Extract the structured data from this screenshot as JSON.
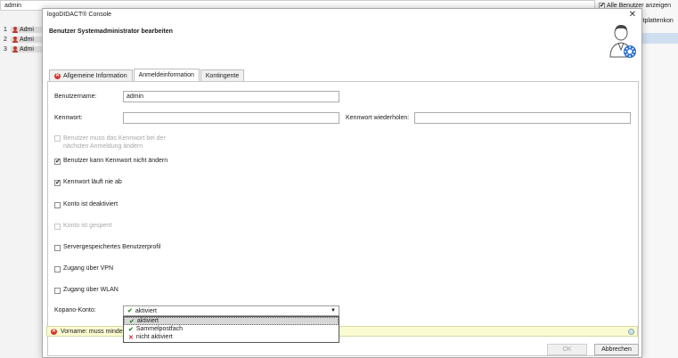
{
  "background": {
    "search_value": "admin",
    "show_all_label": "Alle Benutzer anzeigen",
    "column_header": "stplattenkon",
    "rows": [
      {
        "num": "1",
        "name": "Admi"
      },
      {
        "num": "2",
        "name": "Admi"
      },
      {
        "num": "3",
        "name": "Admi"
      }
    ]
  },
  "dialog": {
    "window_title": "logoDIDACT® Console",
    "header_title": "Benutzer Systemadministrator bearbeiten",
    "tabs": [
      {
        "label": "Allgemeine Information",
        "has_error": true
      },
      {
        "label": "Anmeldeinformation",
        "active": true
      },
      {
        "label": "Kontingente"
      }
    ],
    "username_label": "Benutzername:",
    "username_value": "admin",
    "password_label": "Kennwort:",
    "password_value": "",
    "password_repeat_label": "Kennwort wiederholen:",
    "password_repeat_value": "",
    "options": [
      {
        "label": "Benutzer muss das Kennwort bei der nächsten Anmeldung ändern",
        "line1": "Benutzer muss das Kennwort bei der",
        "line2": "nächsten Anmeldung ändern",
        "checked": false,
        "disabled": true
      },
      {
        "label": "Benutzer kann Kennwort nicht ändern",
        "checked": true,
        "disabled": false
      },
      {
        "label": "Kennwort läuft nie ab",
        "checked": true,
        "disabled": false
      },
      {
        "label": "Konto ist deaktiviert",
        "checked": false,
        "disabled": false
      },
      {
        "label": "Konto ist gesperrt",
        "checked": false,
        "disabled": true
      },
      {
        "label": "Servergespeichertes Benutzerprofil",
        "checked": false,
        "disabled": false
      },
      {
        "label": "Zugang über VPN",
        "checked": false,
        "disabled": false
      },
      {
        "label": "Zugang über WLAN",
        "checked": false,
        "disabled": false
      }
    ],
    "kopano_label": "Kopano-Konto:",
    "kopano_value": "aktiviert",
    "kopano_options": [
      {
        "label": "aktiviert",
        "status": "green",
        "selected": true
      },
      {
        "label": "Sammelpostfach",
        "status": "green"
      },
      {
        "label": "nicht aktiviert",
        "status": "red"
      }
    ],
    "error_text": "Vorname: muss mindes",
    "ok_label": "OK",
    "cancel_label": "Abbrechen"
  },
  "colors": {
    "error_red": "#d9342b",
    "check_green": "#2e8b2e",
    "warning_bg": "#fbfbd2"
  }
}
